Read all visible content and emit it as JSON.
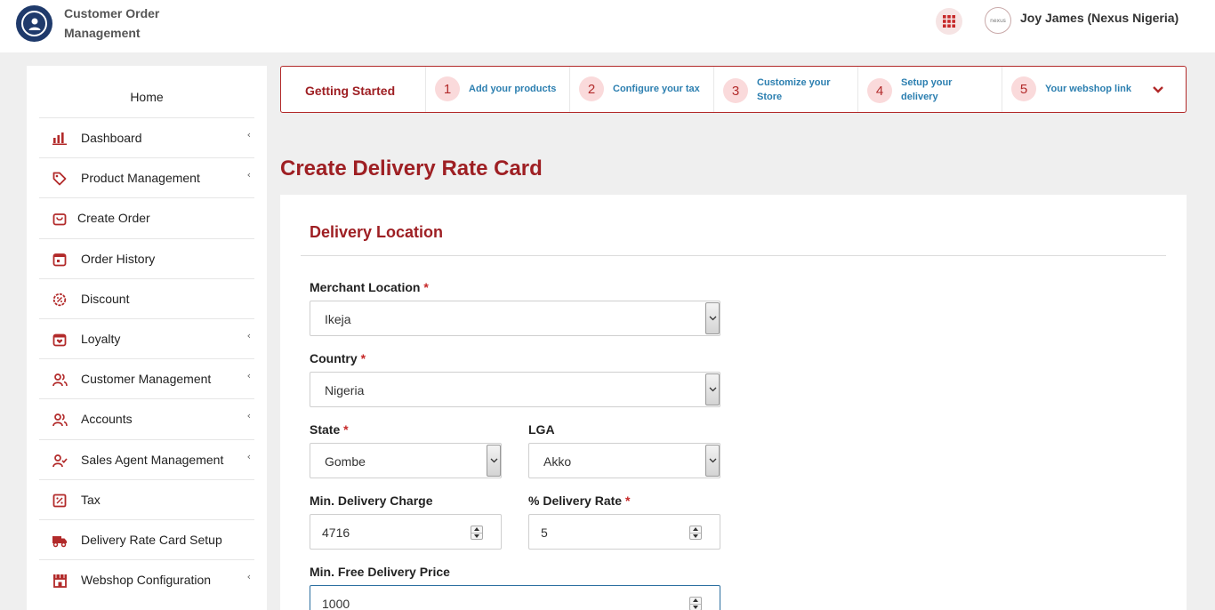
{
  "header": {
    "app_title": "Customer Order Management",
    "user_name": "Joy James (Nexus Nigeria)",
    "avatar_text": "nexus"
  },
  "sidebar": {
    "home_label": "Home",
    "items": [
      {
        "label": "Dashboard",
        "icon": "bar-chart-icon",
        "has_submenu": true
      },
      {
        "label": "Product Management",
        "icon": "tag-icon",
        "has_submenu": true
      },
      {
        "label": "Create Order",
        "icon": "shopping-bag-icon",
        "has_submenu": false
      },
      {
        "label": "Order History",
        "icon": "history-icon",
        "has_submenu": false
      },
      {
        "label": "Discount",
        "icon": "discount-icon",
        "has_submenu": false
      },
      {
        "label": "Loyalty",
        "icon": "loyalty-icon",
        "has_submenu": true
      },
      {
        "label": "Customer Management",
        "icon": "users-icon",
        "has_submenu": true
      },
      {
        "label": "Accounts",
        "icon": "accounts-icon",
        "has_submenu": true
      },
      {
        "label": "Sales Agent Management",
        "icon": "user-check-icon",
        "has_submenu": true
      },
      {
        "label": "Tax",
        "icon": "percent-icon",
        "has_submenu": false
      },
      {
        "label": "Delivery Rate Card Setup",
        "icon": "truck-icon",
        "has_submenu": false
      },
      {
        "label": "Webshop Configuration",
        "icon": "store-icon",
        "has_submenu": true
      }
    ]
  },
  "getting_started": {
    "title": "Getting Started",
    "steps": [
      {
        "num": "1",
        "label": "Add your products"
      },
      {
        "num": "2",
        "label": "Configure your tax"
      },
      {
        "num": "3",
        "label_line1": "Customize your",
        "label_line2": "Store"
      },
      {
        "num": "4",
        "label_line1": "Setup your",
        "label_line2": "delivery"
      },
      {
        "num": "5",
        "label": "Your webshop link"
      }
    ]
  },
  "page": {
    "title": "Create Delivery Rate Card",
    "section_title": "Delivery Location"
  },
  "form": {
    "required_mark": "*",
    "merchant_location": {
      "label": "Merchant Location",
      "value": "Ikeja"
    },
    "country": {
      "label": "Country",
      "value": "Nigeria"
    },
    "state": {
      "label": "State",
      "value": "Gombe"
    },
    "lga": {
      "label": "LGA",
      "value": "Akko"
    },
    "min_delivery_charge": {
      "label": "Min. Delivery Charge",
      "value": "4716"
    },
    "delivery_rate": {
      "label": "% Delivery Rate",
      "value": "5"
    },
    "min_free_delivery_price": {
      "label": "Min. Free Delivery Price",
      "value": "1000"
    }
  },
  "colors": {
    "brand": "#9e1f23",
    "link": "#2c7fb0",
    "step_badge_bg": "#fadadb",
    "navy_logo": "#1f3a6b"
  }
}
